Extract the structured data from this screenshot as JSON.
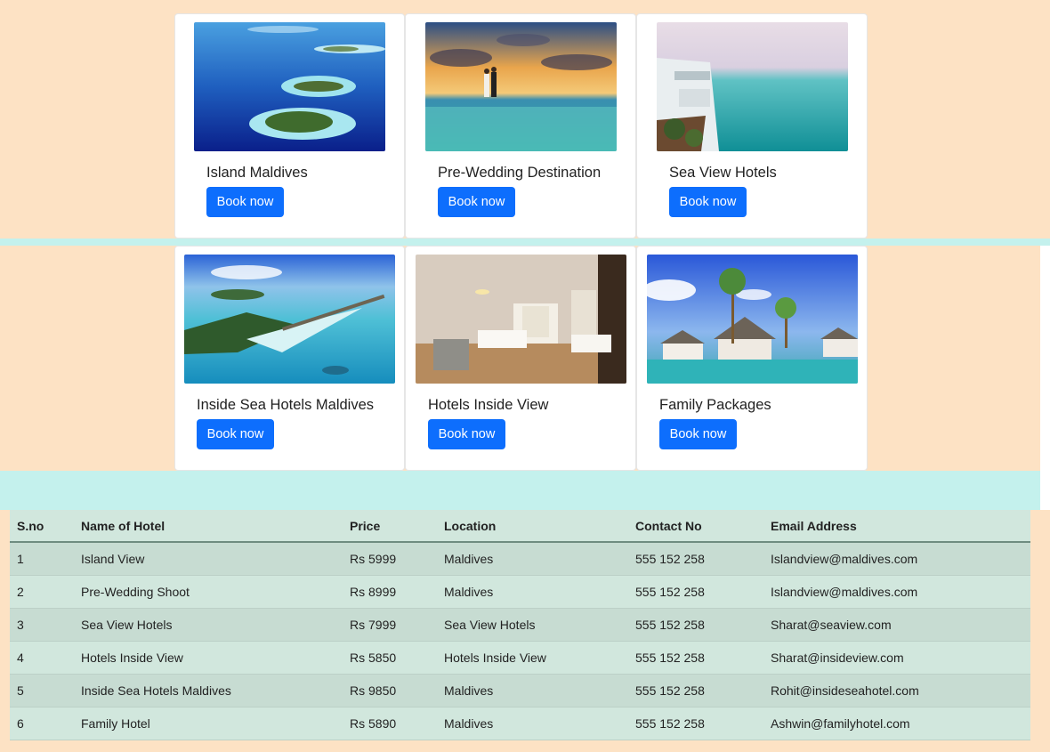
{
  "cards": [
    {
      "title": "Island Maldives",
      "button": "Book now",
      "image": "island-maldives-photo"
    },
    {
      "title": "Pre-Wedding Destination",
      "button": "Book now",
      "image": "pre-wedding-beach-photo"
    },
    {
      "title": "Sea View Hotels",
      "button": "Book now",
      "image": "sea-view-hotel-photo"
    },
    {
      "title": "Inside Sea Hotels Maldives",
      "button": "Book now",
      "image": "water-villas-photo"
    },
    {
      "title": "Hotels Inside View",
      "button": "Book now",
      "image": "hotel-room-photo"
    },
    {
      "title": "Family Packages",
      "button": "Book now",
      "image": "family-resort-photo"
    }
  ],
  "table": {
    "headers": [
      "S.no",
      "Name of Hotel",
      "Price",
      "Location",
      "Contact No",
      "Email Address"
    ],
    "rows": [
      [
        "1",
        "Island View",
        "Rs 5999",
        "Maldives",
        "555 152 258",
        "Islandview@maldives.com"
      ],
      [
        "2",
        "Pre-Wedding Shoot",
        "Rs 8999",
        "Maldives",
        "555 152 258",
        "Islandview@maldives.com"
      ],
      [
        "3",
        "Sea View Hotels",
        "Rs 7999",
        "Sea View Hotels",
        "555 152 258",
        "Sharat@seaview.com"
      ],
      [
        "4",
        "Hotels Inside View",
        "Rs 5850",
        "Hotels Inside View",
        "555 152 258",
        "Sharat@insideview.com"
      ],
      [
        "5",
        "Inside Sea Hotels Maldives",
        "Rs 9850",
        "Maldives",
        "555 152 258",
        "Rohit@insideseahotel.com"
      ],
      [
        "6",
        "Family Hotel",
        "Rs 5890",
        "Maldives",
        "555 152 258",
        "Ashwin@familyhotel.com"
      ]
    ]
  }
}
